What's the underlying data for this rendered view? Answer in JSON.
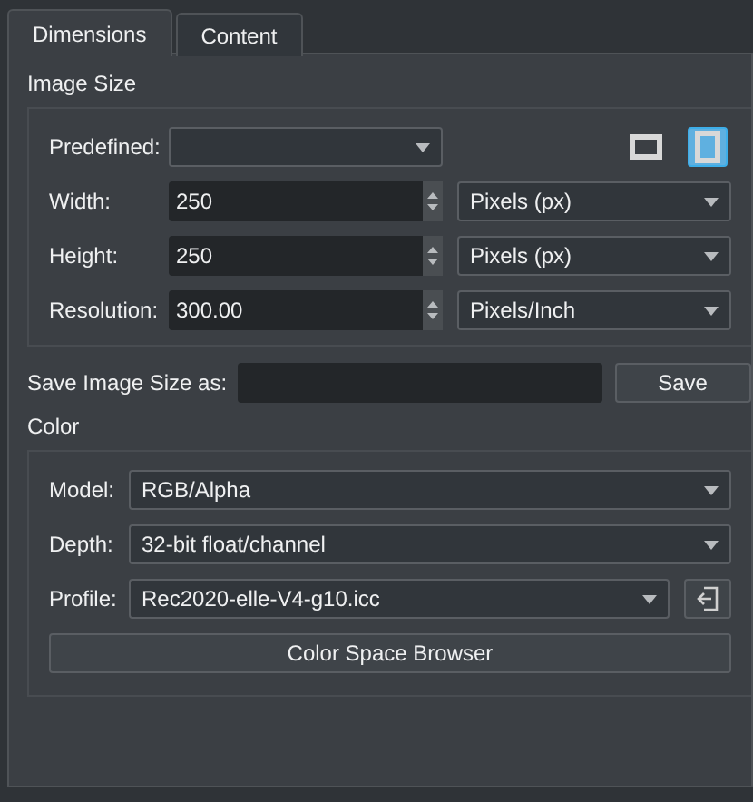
{
  "tabs": [
    {
      "label": "Dimensions",
      "selected": true
    },
    {
      "label": "Content",
      "selected": false
    }
  ],
  "image_size": {
    "title": "Image Size",
    "predefined": {
      "label": "Predefined:"
    },
    "orientations": [
      {
        "kind": "landscape",
        "selected": false
      },
      {
        "kind": "portrait",
        "selected": true
      }
    ],
    "rows": [
      {
        "label": "Width:",
        "value": "250",
        "unit": "Pixels (px)"
      },
      {
        "label": "Height:",
        "value": "250",
        "unit": "Pixels (px)"
      },
      {
        "label": "Resolution:",
        "value": "300.00",
        "unit": "Pixels/Inch"
      }
    ]
  },
  "save_size": {
    "label": "Save Image Size as:",
    "button": "Save"
  },
  "color": {
    "title": "Color",
    "model": {
      "label": "Model:",
      "value": "RGB/Alpha"
    },
    "depth": {
      "label": "Depth:",
      "value": "32-bit float/channel"
    },
    "profile": {
      "label": "Profile:",
      "value": "Rec2020-elle-V4-g10.icc"
    },
    "browser_button": "Color Space Browser"
  }
}
